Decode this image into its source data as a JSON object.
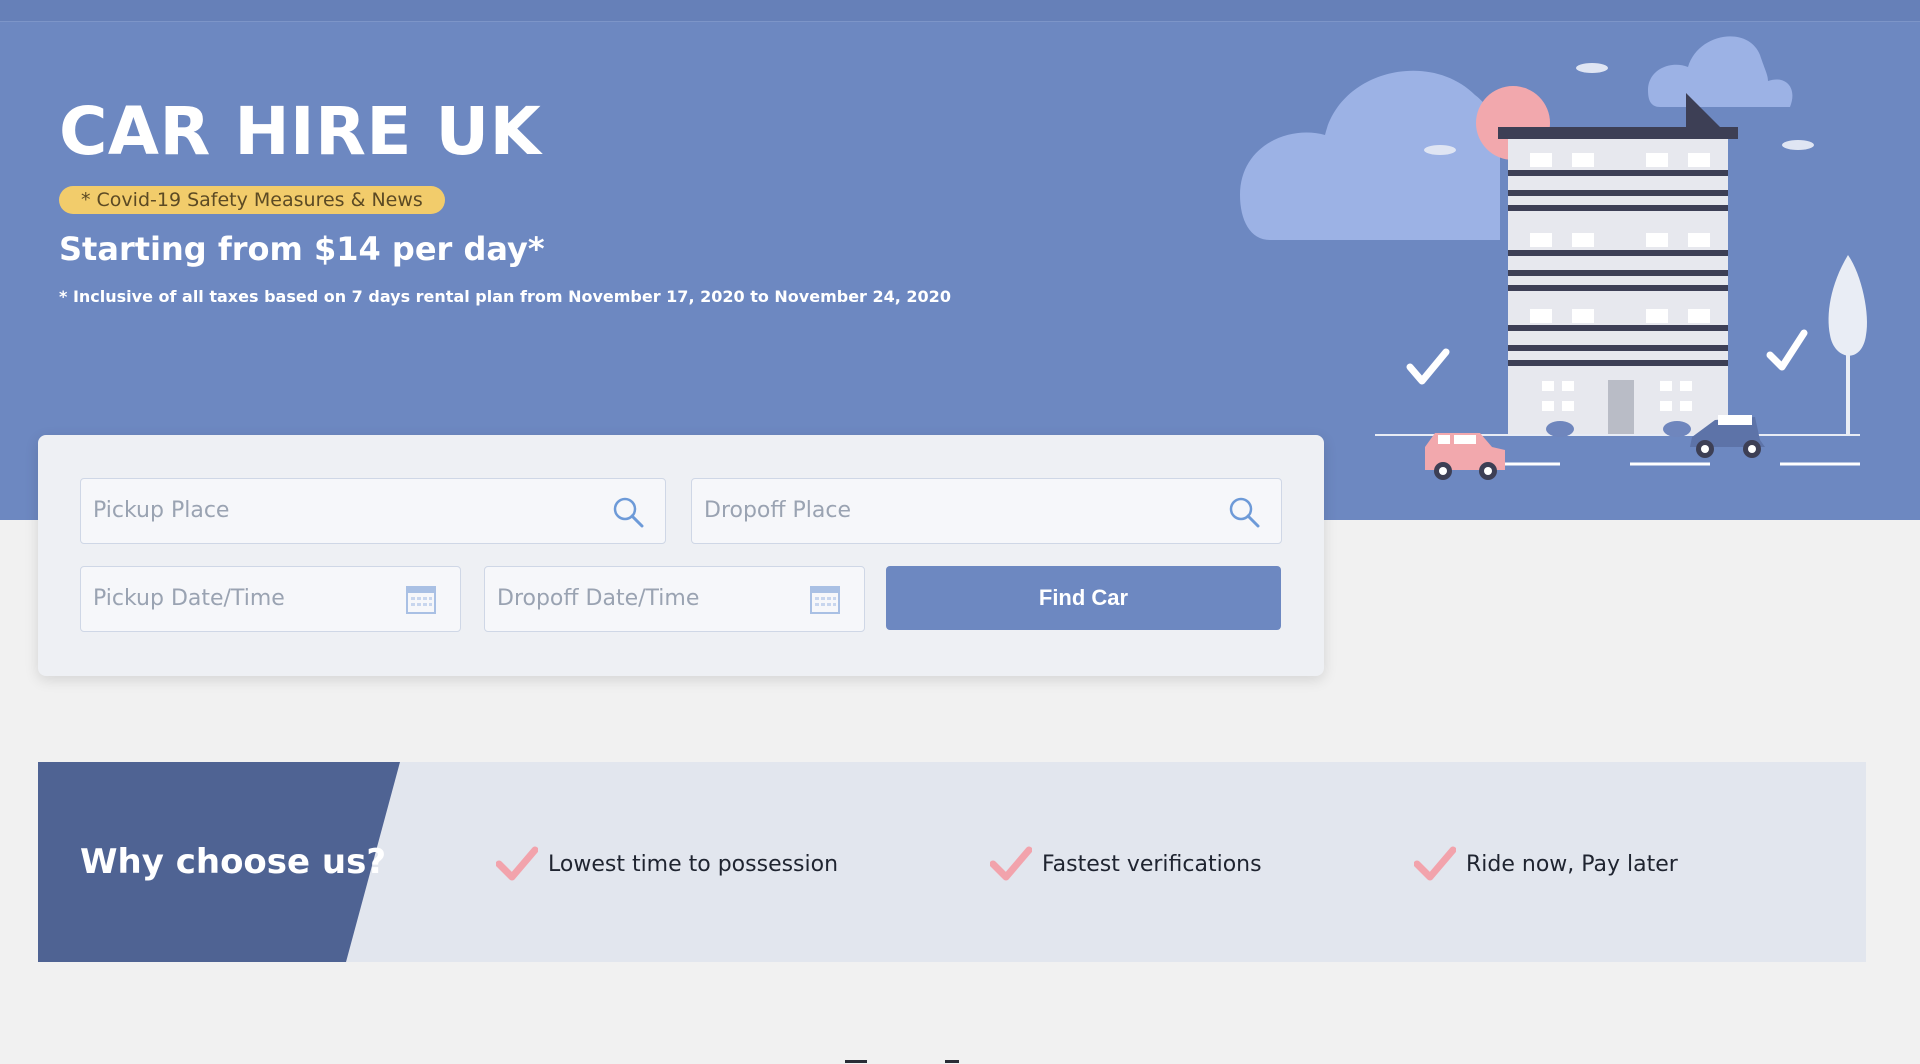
{
  "hero": {
    "title": "CAR HIRE UK",
    "covid_badge": "* Covid-19 Safety Measures & News",
    "price_line": "Starting from $14 per day*",
    "footnote": "* Inclusive of all taxes based on 7 days rental plan from November 17, 2020 to November 24, 2020"
  },
  "search": {
    "pickup_place_placeholder": "Pickup Place",
    "dropoff_place_placeholder": "Dropoff Place",
    "pickup_datetime_placeholder": "Pickup Date/Time",
    "dropoff_datetime_placeholder": "Dropoff Date/Time",
    "find_button_label": "Find Car",
    "place_icon": "search-icon",
    "date_icon": "calendar-icon"
  },
  "why": {
    "title": "Why choose us?",
    "features": [
      {
        "label": "Lowest time to possession",
        "icon": "check-icon"
      },
      {
        "label": "Fastest verifications",
        "icon": "check-icon"
      },
      {
        "label": "Ride now, Pay later",
        "icon": "check-icon"
      }
    ]
  },
  "colors": {
    "hero_bg": "#6d88c1",
    "badge_bg": "#f2cc6b",
    "button_bg": "#6d88c1",
    "why_panel": "#4f6393",
    "check": "#f2a3ac",
    "page_bg": "#f1f1f1"
  }
}
